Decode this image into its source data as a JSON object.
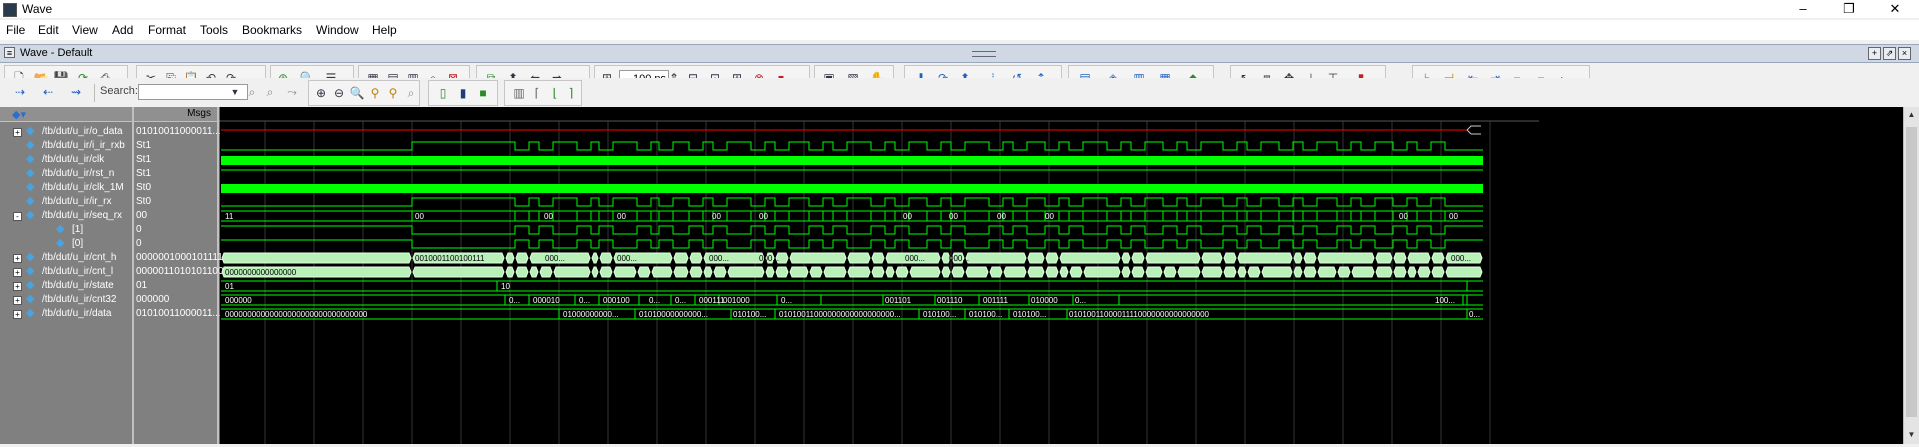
{
  "window": {
    "title": "Wave"
  },
  "menu": [
    "File",
    "Edit",
    "View",
    "Add",
    "Format",
    "Tools",
    "Bookmarks",
    "Window",
    "Help"
  ],
  "pane": {
    "title": "Wave - Default"
  },
  "toolbar": {
    "zoom_value": "100 ns",
    "search_label": "Search:",
    "search_placeholder": ""
  },
  "columns": {
    "msgs_header": "Msgs"
  },
  "signals": [
    {
      "name": "/tb/dut/u_ir/o_data",
      "value": "01010011000011...",
      "expand": "+"
    },
    {
      "name": "/tb/dut/u_ir/i_ir_rxb",
      "value": "St1",
      "expand": ""
    },
    {
      "name": "/tb/dut/u_ir/clk",
      "value": "St1",
      "expand": ""
    },
    {
      "name": "/tb/dut/u_ir/rst_n",
      "value": "St1",
      "expand": ""
    },
    {
      "name": "/tb/dut/u_ir/clk_1M",
      "value": "St0",
      "expand": ""
    },
    {
      "name": "/tb/dut/u_ir/ir_rx",
      "value": "St0",
      "expand": ""
    },
    {
      "name": "/tb/dut/u_ir/seq_rx",
      "value": "00",
      "expand": "-"
    },
    {
      "name": "[1]",
      "value": "0",
      "expand": ""
    },
    {
      "name": "[0]",
      "value": "0",
      "expand": ""
    },
    {
      "name": "/tb/dut/u_ir/cnt_h",
      "value": "0000001000101111",
      "expand": "+"
    },
    {
      "name": "/tb/dut/u_ir/cnt_l",
      "value": "0000011010101100",
      "expand": "+"
    },
    {
      "name": "/tb/dut/u_ir/state",
      "value": "01",
      "expand": "+"
    },
    {
      "name": "/tb/dut/u_ir/cnt32",
      "value": "000000",
      "expand": "+"
    },
    {
      "name": "/tb/dut/u_ir/data",
      "value": "01010011000011...",
      "expand": "+"
    }
  ],
  "wave_labels": {
    "seq_rx": [
      "11",
      "00",
      "00",
      "00",
      "00",
      "00",
      "00",
      "00",
      "00",
      "00",
      "00",
      "00"
    ],
    "cnt_h": [
      "0010001100100111",
      "000...",
      "000...",
      "000...",
      "000...",
      "000...",
      "000...",
      "000..."
    ],
    "cnt_l": [
      "0000000000000000"
    ],
    "state": [
      "01",
      "10"
    ],
    "cnt32": [
      "000000",
      "0...",
      "000010",
      "0...",
      "000100",
      "0...",
      "0...",
      "000111",
      "001000",
      "0...",
      "001101",
      "001110",
      "001111",
      "010000",
      "0...",
      "100..."
    ],
    "data": [
      "00000000000000000000000000000000",
      "01000000000...",
      "01010000000000...",
      "010100...",
      "01010011000000000000000000...",
      "010100...",
      "010100...",
      "010100...",
      "01010011000011110000000000000000",
      "0..."
    ]
  },
  "colors": {
    "wave_green": "#00ff00",
    "wave_red": "#ff0000",
    "bus_fill": "#b8f0b8",
    "value_text": "#ffffff"
  }
}
